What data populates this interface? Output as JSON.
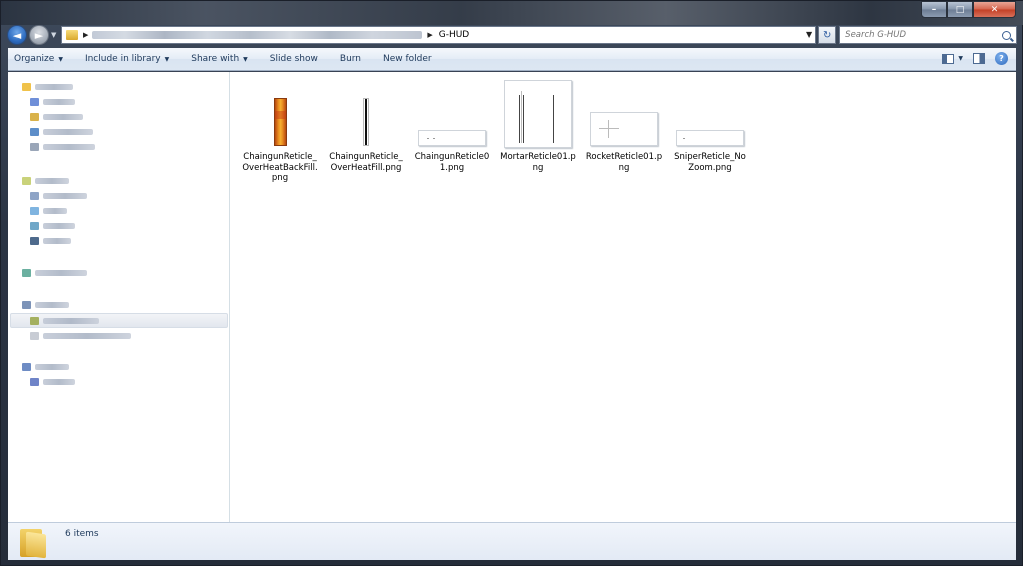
{
  "window": {
    "controls": {
      "minimize": "–",
      "maximize": "□",
      "close": "✕"
    }
  },
  "address": {
    "current_folder": "G-HUD",
    "separator": "▶",
    "dropdown": "▼",
    "refresh_glyph": "↻"
  },
  "search": {
    "placeholder": "Search G-HUD"
  },
  "nav": {
    "back_glyph": "◄",
    "forward_glyph": "►",
    "history_glyph": "▼"
  },
  "toolbar": {
    "items": [
      {
        "label": "Organize",
        "has_dropdown": true
      },
      {
        "label": "Include in library",
        "has_dropdown": true
      },
      {
        "label": "Share with",
        "has_dropdown": true
      },
      {
        "label": "Slide show",
        "has_dropdown": false
      },
      {
        "label": "Burn",
        "has_dropdown": false
      },
      {
        "label": "New folder",
        "has_dropdown": false
      }
    ],
    "caret": "▼",
    "help_glyph": "?"
  },
  "files": [
    {
      "name": "ChaingunReticle_OverHeatBackFill.png",
      "line1": "ChaingunReticle_",
      "line2": "OverHeatBackFill.",
      "line3": "png",
      "thumb": "fill-back"
    },
    {
      "name": "ChaingunReticle_OverHeatFill.png",
      "line1": "ChaingunReticle_",
      "line2": "OverHeatFill.png",
      "line3": "",
      "thumb": "fill"
    },
    {
      "name": "ChaingunReticle01.png",
      "line1": "ChaingunReticle0",
      "line2": "1.png",
      "line3": "",
      "thumb": "flat"
    },
    {
      "name": "MortarReticle01.png",
      "line1": "MortarReticle01.p",
      "line2": "ng",
      "line3": "",
      "thumb": "mortar"
    },
    {
      "name": "RocketReticle01.png",
      "line1": "RocketReticle01.p",
      "line2": "ng",
      "line3": "",
      "thumb": "rocket"
    },
    {
      "name": "SniperReticle_NoZoom.png",
      "line1": "SniperReticle_No",
      "line2": "Zoom.png",
      "line3": "",
      "thumb": "sniper"
    }
  ],
  "details": {
    "item_count": "6 items"
  }
}
